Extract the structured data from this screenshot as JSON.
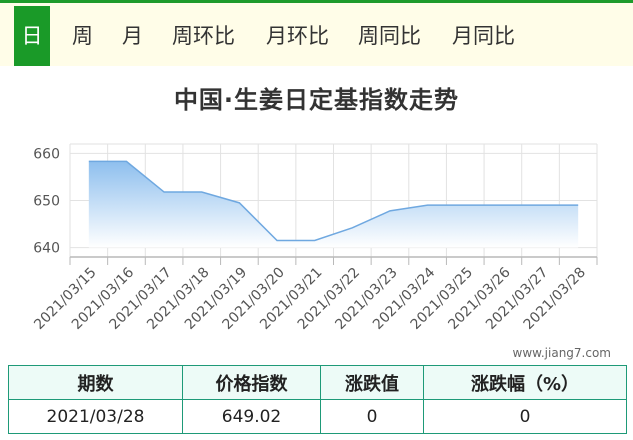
{
  "tabs": [
    {
      "label": "日",
      "active": true
    },
    {
      "label": "周",
      "active": false
    },
    {
      "label": "月",
      "active": false
    },
    {
      "label": "周环比",
      "active": false
    },
    {
      "label": "月环比",
      "active": false
    },
    {
      "label": "周同比",
      "active": false
    },
    {
      "label": "月同比",
      "active": false
    }
  ],
  "colors": {
    "accent": "#1a9a28",
    "tab_bar_bg": "#fffde8",
    "area_top": "#8ebfee",
    "area_bottom": "#ffffff",
    "line": "#6fa8e0",
    "table_border": "#1e9a78",
    "table_header_bg": "#edfbf7"
  },
  "watermark": "www.jiang7.com",
  "chart_data": {
    "type": "area",
    "title": "中国·生姜日定基指数走势",
    "x": [
      "2021/03/15",
      "2021/03/16",
      "2021/03/17",
      "2021/03/18",
      "2021/03/19",
      "2021/03/20",
      "2021/03/21",
      "2021/03/22",
      "2021/03/23",
      "2021/03/24",
      "2021/03/25",
      "2021/03/26",
      "2021/03/27",
      "2021/03/28"
    ],
    "values": [
      658.3,
      658.3,
      651.8,
      651.8,
      649.5,
      641.5,
      641.5,
      644.2,
      647.8,
      649.02,
      649.02,
      649.02,
      649.02,
      649.02
    ],
    "ylim": [
      638,
      662
    ],
    "yticks": [
      640,
      650,
      660
    ],
    "grid": true,
    "legend": "none"
  },
  "summary": {
    "headers": [
      "期数",
      "价格指数",
      "涨跌值",
      "涨跌幅（%）"
    ],
    "row": [
      "2021/03/28",
      "649.02",
      "0",
      "0"
    ]
  }
}
